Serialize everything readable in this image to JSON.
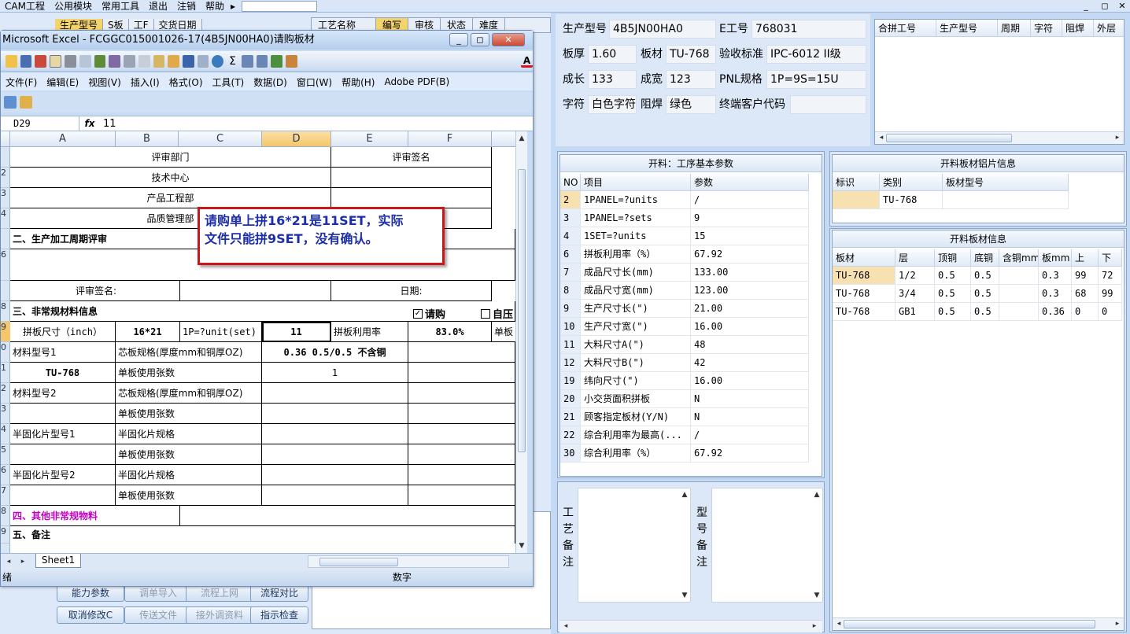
{
  "app": {
    "menu": [
      "CAM工程",
      "公用模块",
      "常用工具",
      "退出",
      "注销",
      "帮助"
    ],
    "window_controls": [
      "_",
      "◻",
      "✕"
    ],
    "bg_header": [
      "生产型号",
      "S板",
      "工F",
      "交货日期"
    ],
    "bg_tabs": [
      "工艺名称",
      "编写",
      "审核",
      "状态",
      "难度"
    ],
    "buttons_row1": [
      "能力参数",
      "调单导入",
      "流程上网",
      "流程对比"
    ],
    "buttons_row2": [
      "取消修改C",
      "传送文件",
      "接外调资料",
      "指示检查"
    ]
  },
  "excel": {
    "title": "Microsoft Excel - FCGGC015001026-17(4B5JN00HA0)请购板材",
    "menu": [
      "文件(F)",
      "编辑(E)",
      "视图(V)",
      "插入(I)",
      "格式(O)",
      "工具(T)",
      "数据(D)",
      "窗口(W)",
      "帮助(H)",
      "Adobe PDF(B)"
    ],
    "name_box": "D29",
    "fx": "fx",
    "formula_value": "11",
    "columns": [
      "A",
      "B",
      "C",
      "D",
      "E",
      "F"
    ],
    "sheet_tab": "Sheet1",
    "status_left": "绪",
    "status_mode": "数字",
    "cells": {
      "r1_dept": "评审部门",
      "r1_sign": "评审签名",
      "r2": "技术中心",
      "r3": "产品工程部",
      "r4": "品质管理部",
      "sec2": "二、生产加工周期评审",
      "sign_label": "评审签名:",
      "date_label": "日期:",
      "sec3": "三、非常规材料信息",
      "chk_qg": "请购",
      "chk_zy": "自压",
      "panel_size": "拼板尺寸（inch）",
      "panel_size_val": "16*21",
      "p_unit": "1P=?unit(set)",
      "p_unit_val": "11",
      "util_label": "拼板利用率",
      "util_val": "83.0%",
      "single_board": "单板",
      "mat1": "材料型号1",
      "core_spec": "芯板规格(厚度mm和铜厚OZ)",
      "core_val": "0.36 0.5/0.5 不含铜",
      "mat1_val": "TU-768",
      "sheets_used": "单板使用张数",
      "sheets_val": "1",
      "mat2": "材料型号2",
      "core_spec2": "芯板规格(厚度mm和铜厚OZ)",
      "sheets_used2": "单板使用张数",
      "pp1": "半固化片型号1",
      "pp_spec1": "半固化片规格",
      "sheets_used3": "单板使用张数",
      "pp2": "半固化片型号2",
      "pp_spec2": "半固化片规格",
      "sheets_used4": "单板使用张数",
      "sec4": "四、其他非常规物料",
      "sec5": "五、备注"
    },
    "row_numbers": [
      "",
      "2",
      "3",
      "4",
      "",
      "6",
      "",
      "8",
      "9",
      "0",
      "1",
      "2",
      "3",
      "4",
      "5",
      "6",
      "7",
      "8",
      "9",
      "0"
    ]
  },
  "annotation": {
    "line1": "请购单上拼16*21是11SET，实际",
    "line2": "文件只能拼9SET，没有确认。"
  },
  "info": {
    "model_label": "生产型号",
    "model": "4B5JN00HA0",
    "eno_label": "E工号",
    "eno": "768031",
    "thick_label": "板厚",
    "thick": "1.60",
    "mat_label": "板材",
    "mat": "TU-768",
    "std_label": "验收标准",
    "std": "IPC-6012 II级",
    "len_label": "成长",
    "len": "133",
    "wid_label": "成宽",
    "wid": "123",
    "pnl_label": "PNL规格",
    "pnl": "1P=9S=15U",
    "silk_label": "字符",
    "silk": "白色字符",
    "mask_label": "阻焊",
    "mask": "绿色",
    "cust_label": "终端客户代码",
    "cust": ""
  },
  "merge_table": {
    "headers": [
      "合拼工号",
      "生产型号",
      "周期",
      "字符",
      "阻焊",
      "外层"
    ]
  },
  "params": {
    "caption": "开料：工序基本参数",
    "headers": [
      "NO",
      "项目",
      "参数"
    ],
    "rows": [
      [
        "2",
        "1PANEL=?units",
        "/"
      ],
      [
        "3",
        "1PANEL=?sets",
        "9"
      ],
      [
        "4",
        "1SET=?units",
        "15"
      ],
      [
        "6",
        "拼板利用率（%）",
        "67.92"
      ],
      [
        "7",
        "成品尺寸长(mm)",
        "133.00"
      ],
      [
        "8",
        "成品尺寸宽(mm)",
        "123.00"
      ],
      [
        "9",
        "生产尺寸长(\")",
        "21.00"
      ],
      [
        "10",
        "生产尺寸宽(\")",
        "16.00"
      ],
      [
        "11",
        "大料尺寸A(\")",
        "48"
      ],
      [
        "12",
        "大料尺寸B(\")",
        "42"
      ],
      [
        "19",
        "纬向尺寸(\")",
        "16.00"
      ],
      [
        "20",
        "小交货面积拼板",
        "N"
      ],
      [
        "21",
        "顾客指定板材(Y/N)",
        "N"
      ],
      [
        "22",
        "综合利用率为最高(...",
        "/"
      ],
      [
        "30",
        "综合利用率（%）",
        "67.92"
      ]
    ]
  },
  "notes": {
    "craft": [
      "工",
      "艺",
      "备",
      "注"
    ],
    "model": [
      "型",
      "号",
      "备",
      "注"
    ]
  },
  "sheet_info": {
    "caption": "开料板材铝片信息",
    "headers": [
      "标识",
      "类别",
      "板材型号"
    ],
    "row": [
      "",
      "TU-768",
      ""
    ]
  },
  "material_info": {
    "caption": "开料板材信息",
    "headers": [
      "板材",
      "层",
      "顶铜",
      "底铜",
      "含铜mm",
      "板mm",
      "上",
      "下"
    ],
    "rows": [
      [
        "TU-768",
        "1/2",
        "0.5",
        "0.5",
        "",
        "0.3",
        "99",
        "72"
      ],
      [
        "TU-768",
        "3/4",
        "0.5",
        "0.5",
        "",
        "0.3",
        "68",
        "99"
      ],
      [
        "TU-768",
        "GB1",
        "0.5",
        "0.5",
        "",
        "0.36",
        "0",
        "0"
      ]
    ]
  }
}
